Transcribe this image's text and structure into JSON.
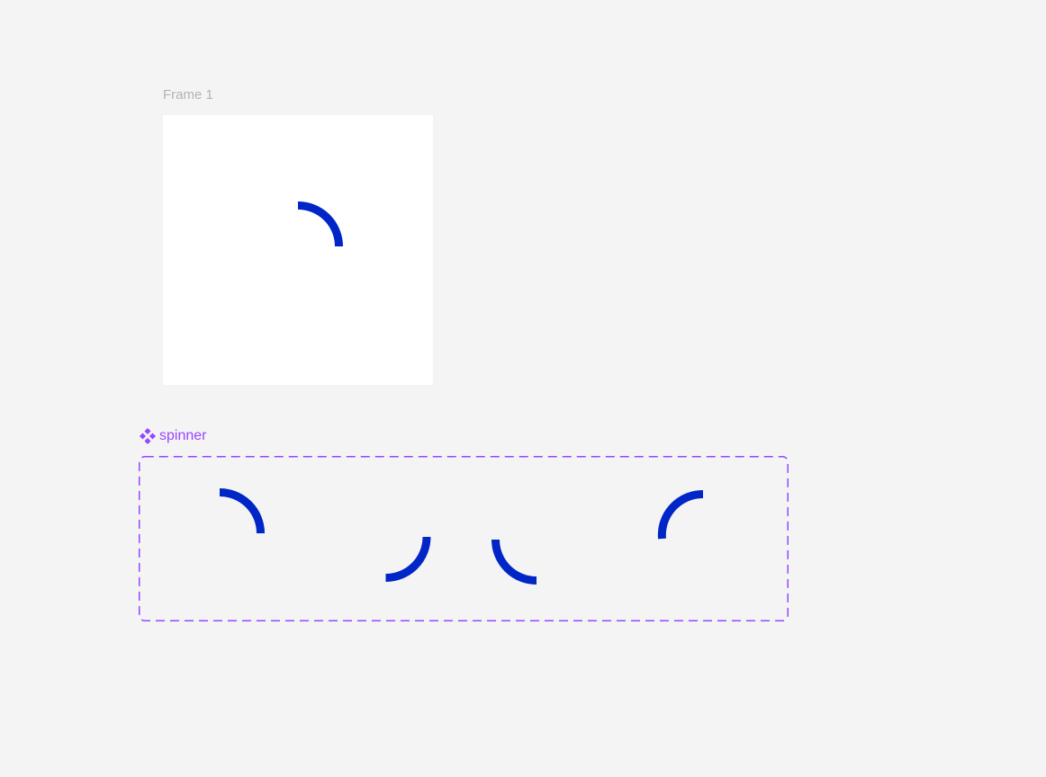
{
  "canvas": {
    "background": "#f4f4f4"
  },
  "frame": {
    "label": "Frame 1",
    "label_color": "#b3b3b3",
    "background": "#ffffff"
  },
  "component": {
    "label": "spinner",
    "icon": "component-diamond-icon",
    "color": "#9747ff"
  },
  "spinner": {
    "color": "#0026c7"
  }
}
